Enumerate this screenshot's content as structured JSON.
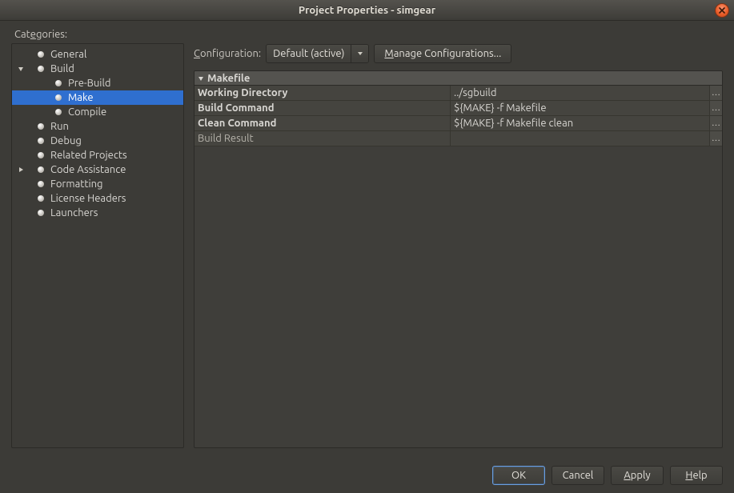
{
  "window": {
    "title": "Project Properties - simgear"
  },
  "left": {
    "categories_label_pre": "Cat",
    "categories_label_ul": "e",
    "categories_label_post": "gories:",
    "tree": [
      {
        "level": 0,
        "label": "General",
        "expandable": false
      },
      {
        "level": 0,
        "label": "Build",
        "expandable": true,
        "expanded": true
      },
      {
        "level": 1,
        "label": "Pre-Build"
      },
      {
        "level": 1,
        "label": "Make",
        "selected": true
      },
      {
        "level": 1,
        "label": "Compile"
      },
      {
        "level": 0,
        "label": "Run",
        "expandable": false
      },
      {
        "level": 0,
        "label": "Debug",
        "expandable": false
      },
      {
        "level": 0,
        "label": "Related Projects",
        "expandable": false
      },
      {
        "level": 0,
        "label": "Code Assistance",
        "expandable": true,
        "expanded": false
      },
      {
        "level": 0,
        "label": "Formatting",
        "expandable": false
      },
      {
        "level": 0,
        "label": "License Headers",
        "expandable": false
      },
      {
        "level": 0,
        "label": "Launchers",
        "expandable": false
      }
    ]
  },
  "config": {
    "label_ul": "C",
    "label_rest": "onfiguration:",
    "selected": "Default (active)",
    "manage_ul": "M",
    "manage_rest": "anage Configurations..."
  },
  "props": {
    "section": "Makefile",
    "rows": [
      {
        "k": "Working Directory",
        "v": "../sgbuild",
        "bold": true,
        "ell": true
      },
      {
        "k": "Build Command",
        "v": "${MAKE}  -f Makefile",
        "bold": true,
        "ell": true
      },
      {
        "k": "Clean Command",
        "v": "${MAKE}  -f Makefile clean",
        "bold": true,
        "ell": true
      },
      {
        "k": "Build Result",
        "v": "",
        "bold": false,
        "ell": true
      }
    ]
  },
  "footer": {
    "ok": "OK",
    "cancel": "Cancel",
    "apply_ul": "A",
    "apply_rest": "pply",
    "help_ul": "H",
    "help_rest": "elp"
  }
}
